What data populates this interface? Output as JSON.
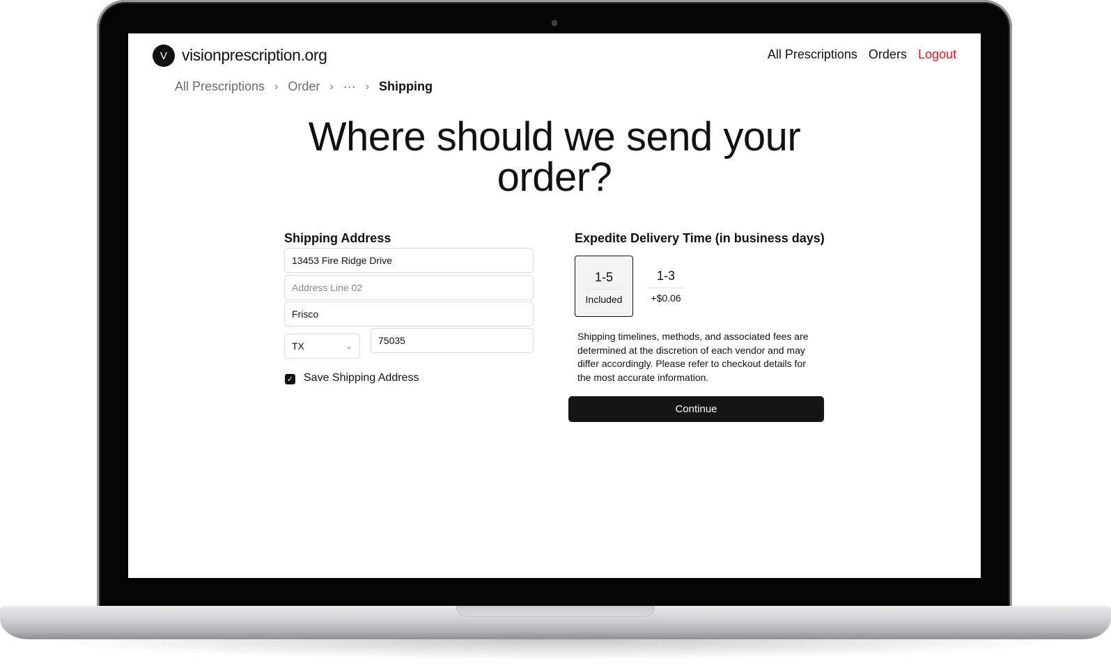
{
  "header": {
    "logo_letter": "V",
    "site_name": "visionprescription.org",
    "nav": {
      "all_prescriptions": "All Prescriptions",
      "orders": "Orders",
      "logout": "Logout"
    }
  },
  "breadcrumb": {
    "items": [
      "All Prescriptions",
      "Order",
      "···"
    ],
    "current": "Shipping",
    "separator": "›"
  },
  "page_title": "Where should we send your order?",
  "shipping": {
    "label": "Shipping Address",
    "address_line_1": "13453 Fire Ridge Drive",
    "address_line_2_placeholder": "Address Line 02",
    "city": "Frisco",
    "state": "TX",
    "zip": "75035",
    "save_address_checked": true,
    "save_address_label": "Save Shipping Address"
  },
  "delivery": {
    "label": "Expedite Delivery Time (in business days)",
    "options": [
      {
        "days": "1-5",
        "price": "Included",
        "selected": true
      },
      {
        "days": "1-3",
        "price": "+$0.06",
        "selected": false
      }
    ],
    "note": "Shipping timelines, methods, and associated fees are determined at the discretion of each vendor and may differ accordingly. Please refer to checkout details for the most accurate information.",
    "continue_label": "Continue"
  },
  "icons": {
    "checkbox": "check-icon",
    "select": "chevron-down-icon",
    "breadcrumb_separator": "chevron-right-icon"
  },
  "colors": {
    "accent_logout": "#e0191e",
    "primary_button": "#151515"
  }
}
